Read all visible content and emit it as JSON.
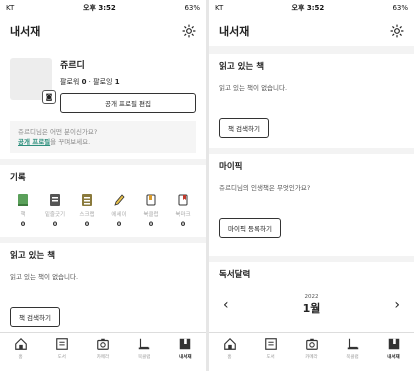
{
  "status": {
    "carrier": "KT",
    "time": "오후 3:52",
    "battery": "63%"
  },
  "app": {
    "title": "내서재"
  },
  "profile": {
    "name": "쥬르디",
    "followers_label": "팔로워",
    "followers": "0",
    "following_label": "팔로잉",
    "following": "1",
    "edit_button": "공개 프로필 편집"
  },
  "ask": {
    "prefix": "쥬르디님은 어떤 분이신가요?",
    "link": "공개 프로필",
    "suffix": "을 꾸며보세요."
  },
  "records": {
    "title": "기록",
    "items": [
      {
        "label": "책",
        "count": "0",
        "icon": "book-icon",
        "color": "#5aa05a"
      },
      {
        "label": "밑줄긋기",
        "count": "0",
        "icon": "underline-icon",
        "color": "#444444"
      },
      {
        "label": "스크랩",
        "count": "0",
        "icon": "scrap-icon",
        "color": "#8a7a3c"
      },
      {
        "label": "에세이",
        "count": "0",
        "icon": "pencil-icon",
        "color": "#444444"
      },
      {
        "label": "북클럽",
        "count": "0",
        "icon": "bookclub-icon",
        "color": "#d99a2b"
      },
      {
        "label": "북마크",
        "count": "0",
        "icon": "bookmark-icon",
        "color": "#c0392b"
      }
    ]
  },
  "reading": {
    "title": "읽고 있는 책",
    "empty": "읽고 있는 책이 없습니다.",
    "button": "책 검색하기"
  },
  "mypick": {
    "title": "마이픽",
    "question": "쥬르디님의 인생책은 무엇인가요?",
    "button": "마이픽 등록하기"
  },
  "calendar": {
    "title": "독서달력",
    "year": "2022",
    "month": "1월"
  },
  "tabs": [
    {
      "label": "홈",
      "icon": "home-icon"
    },
    {
      "label": "도서",
      "icon": "library-icon"
    },
    {
      "label": "카메라",
      "icon": "camera-icon"
    },
    {
      "label": "북클럽",
      "icon": "bookclub-icon"
    },
    {
      "label": "내서재",
      "icon": "my-library-icon"
    }
  ]
}
